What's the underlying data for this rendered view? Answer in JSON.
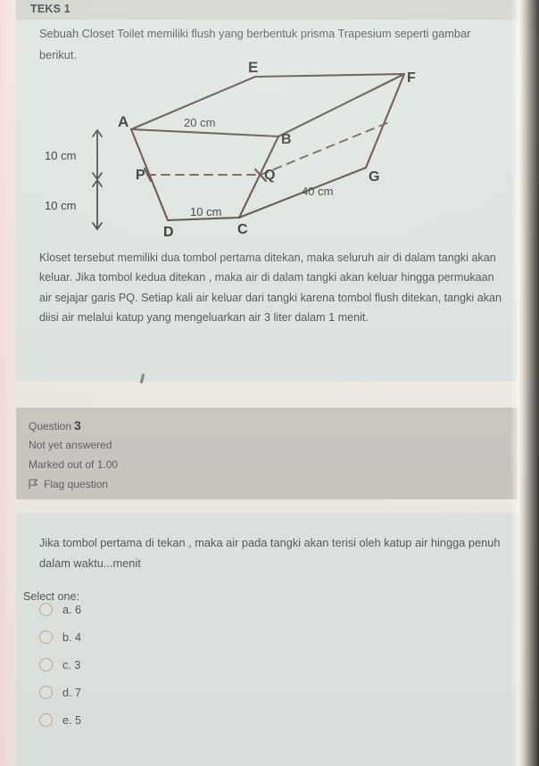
{
  "teks": {
    "title": "TEKS 1",
    "intro": "Sebuah Closet Toilet memiliki flush yang berbentuk prisma Trapesium seperti gambar berikut.",
    "body": "Kloset tersebut memiliki dua tombol pertama ditekan, maka seluruh air di dalam tangki akan keluar. Jika tombol kedua ditekan , maka air di dalam tangki akan keluar hingga permukaan air sejajar garis PQ. Setiap kali air keluar dari tangki karena tombol flush ditekan, tangki akan diisi air melalui katup yang mengeluarkan air 3 liter dalam 1 menit."
  },
  "figure": {
    "description": "trapezoidal-prism-diagram",
    "vertices": {
      "A": "A",
      "B": "B",
      "C": "C",
      "D": "D",
      "E": "E",
      "F": "F",
      "G": "G",
      "P": "P",
      "Q": "Q"
    },
    "labels": {
      "top_edge": "20 cm",
      "bottom_edge": "10 cm",
      "depth_edge": "40 cm",
      "height_upper": "10 cm",
      "height_lower": "10 cm"
    }
  },
  "question_meta": {
    "question_word": "Question",
    "question_number": "3",
    "status": "Not yet answered",
    "marked": "Marked out of 1.00",
    "flag_label": "Flag question",
    "flag_icon": "flag-icon"
  },
  "question": {
    "text": "Jika tombol pertama di tekan , maka air pada tangki akan terisi oleh katup air hingga penuh dalam waktu...menit",
    "select_one": "Select one:",
    "options": [
      {
        "label": "a. 6",
        "selected": false
      },
      {
        "label": "b. 4",
        "selected": false
      },
      {
        "label": "c. 3",
        "selected": false
      },
      {
        "label": "d. 7",
        "selected": false
      },
      {
        "label": "e. 5",
        "selected": false
      }
    ]
  },
  "colors": {
    "panel_bg": "#dfe5e1",
    "meta_bg": "#cbc7c1",
    "text": "#54585b",
    "diagram_stroke": "#5b4a46"
  }
}
